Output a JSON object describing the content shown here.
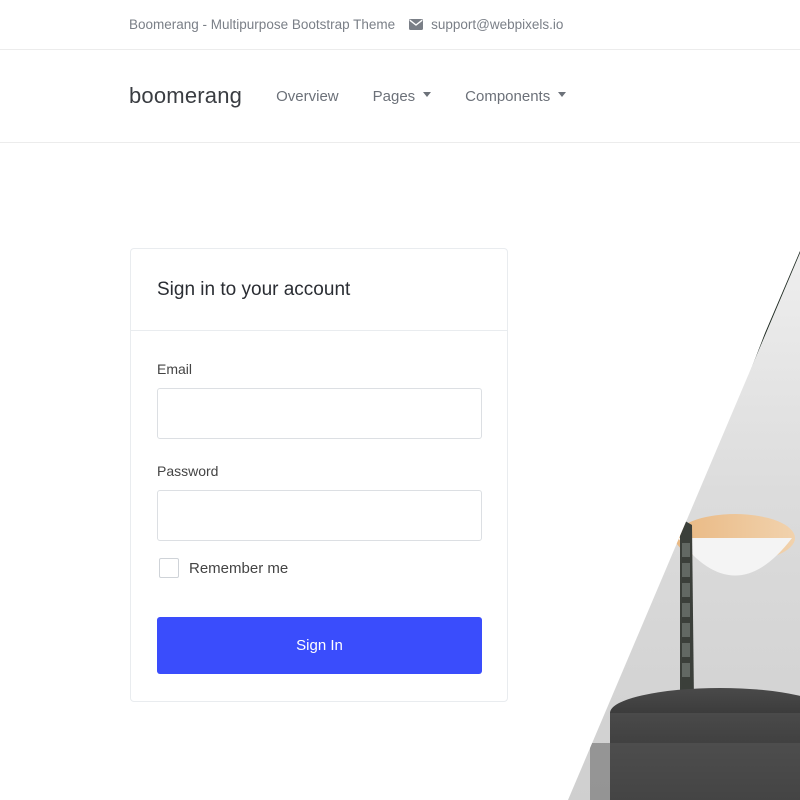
{
  "topbar": {
    "tagline": "Boomerang - Multipurpose Bootstrap Theme",
    "email": "support@webpixels.io",
    "email_icon": "envelope-icon"
  },
  "navbar": {
    "brand": "boomerang",
    "items": [
      {
        "label": "Overview",
        "has_dropdown": false
      },
      {
        "label": "Pages",
        "has_dropdown": true
      },
      {
        "label": "Components",
        "has_dropdown": true
      }
    ]
  },
  "signin": {
    "title": "Sign in to your account",
    "email_label": "Email",
    "email_value": "",
    "password_label": "Password",
    "password_value": "",
    "remember_label": "Remember me",
    "remember_checked": false,
    "submit_label": "Sign In"
  },
  "colors": {
    "primary": "#3a4dfc",
    "border": "#e9ecef",
    "muted_text": "#7a7f87"
  }
}
